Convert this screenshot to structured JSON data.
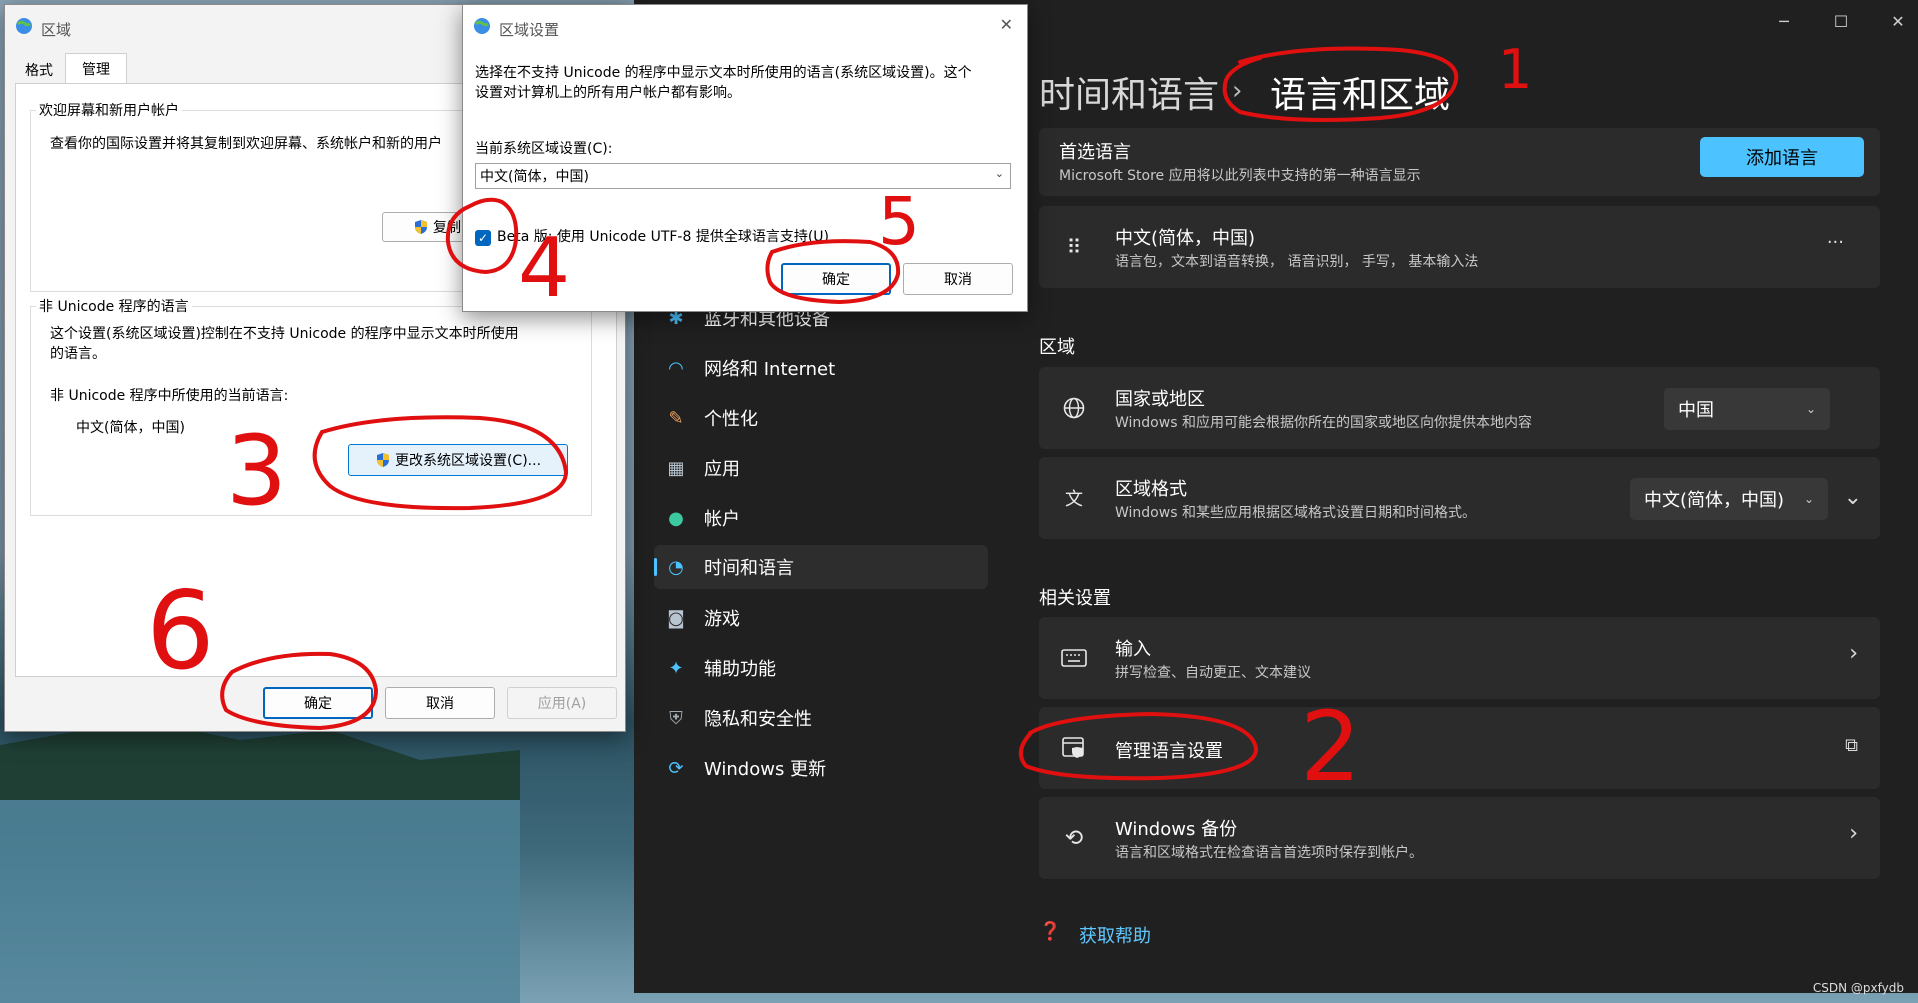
{
  "settings": {
    "breadcrumb": {
      "parent": "时间和语言",
      "separator": "›",
      "current": "语言和区域"
    },
    "window_controls": {
      "minimize": "─",
      "maximize": "☐",
      "close": "✕"
    },
    "nav": [
      {
        "label": "蓝牙和其他设备",
        "icon": "bluetooth-icon"
      },
      {
        "label": "网络和 Internet",
        "icon": "wifi-icon"
      },
      {
        "label": "个性化",
        "icon": "brush-icon"
      },
      {
        "label": "应用",
        "icon": "apps-icon"
      },
      {
        "label": "帐户",
        "icon": "person-icon"
      },
      {
        "label": "时间和语言",
        "icon": "clock-globe-icon",
        "active": true
      },
      {
        "label": "游戏",
        "icon": "gamepad-icon"
      },
      {
        "label": "辅助功能",
        "icon": "accessibility-icon"
      },
      {
        "label": "隐私和安全性",
        "icon": "shield-icon"
      },
      {
        "label": "Windows 更新",
        "icon": "update-icon"
      }
    ],
    "preferred": {
      "title": "首选语言",
      "subtitle": "Microsoft Store 应用将以此列表中支持的第一种语言显示",
      "add_button": "添加语言"
    },
    "language_item": {
      "title": "中文(简体，中国)",
      "subtitle": "语言包，文本到语音转换， 语音识别， 手写， 基本输入法",
      "more": "···"
    },
    "region_section": "区域",
    "country": {
      "title": "国家或地区",
      "subtitle": "Windows 和应用可能会根据你所在的国家或地区向你提供本地内容",
      "value": "中国"
    },
    "format": {
      "title": "区域格式",
      "subtitle": "Windows 和某些应用根据区域格式设置日期和时间格式。",
      "value": "中文(简体，中国)"
    },
    "related_section": "相关设置",
    "input": {
      "title": "输入",
      "subtitle": "拼写检查、自动更正、文本建议"
    },
    "manage": {
      "title": "管理语言设置"
    },
    "backup": {
      "title": "Windows 备份",
      "subtitle": "语言和区域格式在检查语言首选项时保存到帐户。"
    },
    "help": "获取帮助"
  },
  "region_dialog": {
    "title": "区域",
    "tabs": [
      "格式",
      "管理"
    ],
    "welcome_group": {
      "label": "欢迎屏幕和新用户帐户",
      "text": "查看你的国际设置并将其复制到欢迎屏幕、系统帐户和新的用户",
      "copy_button": "复制"
    },
    "unicode_group": {
      "label": "非 Unicode 程序的语言",
      "text1": "这个设置(系统区域设置)控制在不支持 Unicode 的程序中显示文本时所使用",
      "text2": "的语言。",
      "current_label": "非 Unicode 程序中所使用的当前语言:",
      "current_value": "中文(简体，中国)",
      "change_button": "更改系统区域设置(C)..."
    },
    "ok": "确定",
    "cancel": "取消",
    "apply": "应用(A)"
  },
  "locale_dialog": {
    "title": "区域设置",
    "close": "✕",
    "desc1": "选择在不支持 Unicode 的程序中显示文本时所使用的语言(系统区域设置)。这个",
    "desc2": "设置对计算机上的所有用户帐户都有影响。",
    "current_label": "当前系统区域设置(C):",
    "current_value": "中文(简体，中国)",
    "beta_label": "Beta 版: 使用 Unicode UTF-8 提供全球语言支持(U)",
    "beta_checked": true,
    "ok": "确定",
    "cancel": "取消"
  },
  "annotations": [
    "1",
    "2",
    "3",
    "4",
    "5",
    "6"
  ],
  "watermark": "CSDN @pxfydb",
  "colors": {
    "accent": "#4cc2ff",
    "dark_bg": "#202020",
    "card_bg": "#2b2b2b",
    "annotation_red": "#e01010"
  }
}
